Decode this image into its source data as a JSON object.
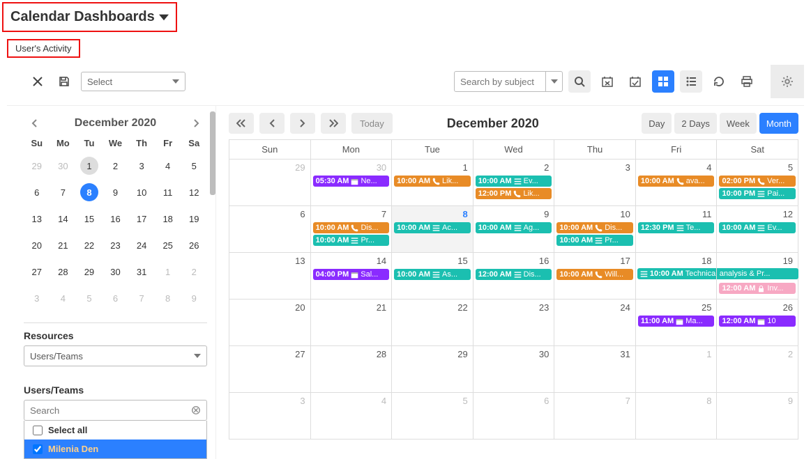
{
  "header": {
    "title": "Calendar Dashboards"
  },
  "tabs": {
    "active": "User's Activity"
  },
  "toolbar": {
    "select_placeholder": "Select",
    "search_placeholder": "Search by subject"
  },
  "mini_calendar": {
    "title": "December 2020",
    "dow": [
      "Su",
      "Mo",
      "Tu",
      "We",
      "Th",
      "Fr",
      "Sa"
    ],
    "weeks": [
      [
        {
          "n": 29,
          "dim": true
        },
        {
          "n": 30,
          "dim": true
        },
        {
          "n": 1,
          "today": true
        },
        {
          "n": 2
        },
        {
          "n": 3
        },
        {
          "n": 4
        },
        {
          "n": 5
        }
      ],
      [
        {
          "n": 6
        },
        {
          "n": 7
        },
        {
          "n": 8,
          "sel": true
        },
        {
          "n": 9
        },
        {
          "n": 10
        },
        {
          "n": 11
        },
        {
          "n": 12
        }
      ],
      [
        {
          "n": 13
        },
        {
          "n": 14
        },
        {
          "n": 15
        },
        {
          "n": 16
        },
        {
          "n": 17
        },
        {
          "n": 18
        },
        {
          "n": 19
        }
      ],
      [
        {
          "n": 20
        },
        {
          "n": 21
        },
        {
          "n": 22
        },
        {
          "n": 23
        },
        {
          "n": 24
        },
        {
          "n": 25
        },
        {
          "n": 26
        }
      ],
      [
        {
          "n": 27
        },
        {
          "n": 28
        },
        {
          "n": 29
        },
        {
          "n": 30
        },
        {
          "n": 31
        },
        {
          "n": 1,
          "dim": true
        },
        {
          "n": 2,
          "dim": true
        }
      ],
      [
        {
          "n": 3,
          "dim": true
        },
        {
          "n": 4,
          "dim": true
        },
        {
          "n": 5,
          "dim": true
        },
        {
          "n": 6,
          "dim": true
        },
        {
          "n": 7,
          "dim": true
        },
        {
          "n": 8,
          "dim": true
        },
        {
          "n": 9,
          "dim": true
        }
      ]
    ]
  },
  "resources": {
    "label": "Resources",
    "value": "Users/Teams"
  },
  "users_teams": {
    "label": "Users/Teams",
    "search_placeholder": "Search",
    "select_all": "Select all",
    "items": [
      {
        "name": "Milenia Den",
        "checked": true,
        "selected": true
      }
    ]
  },
  "calendar": {
    "title": "December 2020",
    "today_label": "Today",
    "views": [
      "Day",
      "2 Days",
      "Week",
      "Month"
    ],
    "active_view": "Month",
    "dow": [
      "Sun",
      "Mon",
      "Tue",
      "Wed",
      "Thu",
      "Fri",
      "Sat"
    ],
    "weeks": [
      {
        "days": [
          {
            "n": 29,
            "dim": true,
            "events": []
          },
          {
            "n": 30,
            "dim": true,
            "events": [
              {
                "t": "05:30 AM",
                "c": "purple",
                "i": "cal",
                "txt": "Ne..."
              }
            ]
          },
          {
            "n": 1,
            "events": [
              {
                "t": "10:00 AM",
                "c": "orange",
                "i": "phone",
                "txt": "Lik..."
              }
            ]
          },
          {
            "n": 2,
            "events": [
              {
                "t": "10:00 AM",
                "c": "teal",
                "i": "list",
                "txt": "Ev..."
              },
              {
                "t": "12:00 PM",
                "c": "orange",
                "i": "phone",
                "txt": "Lik..."
              }
            ]
          },
          {
            "n": 3,
            "events": []
          },
          {
            "n": 4,
            "events": [
              {
                "t": "10:00 AM",
                "c": "orange",
                "i": "phone",
                "txt": "ava..."
              }
            ]
          },
          {
            "n": 5,
            "events": [
              {
                "t": "02:00 PM",
                "c": "orange",
                "i": "phone",
                "txt": "Ver..."
              },
              {
                "t": "10:00 PM",
                "c": "teal",
                "i": "list",
                "txt": "Pai..."
              }
            ]
          }
        ]
      },
      {
        "days": [
          {
            "n": 6,
            "events": []
          },
          {
            "n": 7,
            "events": [
              {
                "t": "10:00 AM",
                "c": "orange",
                "i": "phone",
                "txt": "Dis..."
              },
              {
                "t": "10:00 AM",
                "c": "teal",
                "i": "list",
                "txt": "Pr..."
              }
            ]
          },
          {
            "n": 8,
            "sel": true,
            "today": true,
            "events": [
              {
                "t": "10:00 AM",
                "c": "teal",
                "i": "list",
                "txt": "Ac..."
              }
            ]
          },
          {
            "n": 9,
            "events": [
              {
                "t": "10:00 AM",
                "c": "teal",
                "i": "list",
                "txt": "Ag..."
              }
            ]
          },
          {
            "n": 10,
            "events": [
              {
                "t": "10:00 AM",
                "c": "orange",
                "i": "phone",
                "txt": "Dis..."
              },
              {
                "t": "10:00 AM",
                "c": "teal",
                "i": "list",
                "txt": "Pr..."
              }
            ]
          },
          {
            "n": 11,
            "events": [
              {
                "t": "12:30 PM",
                "c": "teal",
                "i": "list",
                "txt": "Te..."
              }
            ]
          },
          {
            "n": 12,
            "events": [
              {
                "t": "10:00 AM",
                "c": "teal",
                "i": "list",
                "txt": "Ev..."
              }
            ]
          }
        ]
      },
      {
        "days": [
          {
            "n": 13,
            "events": []
          },
          {
            "n": 14,
            "events": [
              {
                "t": "04:00 PM",
                "c": "purple",
                "i": "cal",
                "txt": "Sal..."
              }
            ]
          },
          {
            "n": 15,
            "events": [
              {
                "t": "10:00 AM",
                "c": "teal",
                "i": "list",
                "txt": "As..."
              }
            ]
          },
          {
            "n": 16,
            "events": [
              {
                "t": "12:00 AM",
                "c": "teal",
                "i": "list",
                "txt": "Dis..."
              }
            ]
          },
          {
            "n": 17,
            "events": [
              {
                "t": "10:00 AM",
                "c": "orange",
                "i": "phone",
                "txt": "Will..."
              }
            ]
          },
          {
            "n": 18,
            "span_start": true,
            "events": []
          },
          {
            "n": 19,
            "events": [
              {
                "t": "12:00 AM",
                "c": "pink",
                "i": "lock",
                "txt": "Inv..."
              }
            ]
          }
        ],
        "span": {
          "t": "10:00 AM",
          "c": "teal",
          "i": "list",
          "txt": "Technical analysis & Pr...",
          "from": 5,
          "to": 6
        }
      },
      {
        "days": [
          {
            "n": 20,
            "events": []
          },
          {
            "n": 21,
            "events": []
          },
          {
            "n": 22,
            "events": []
          },
          {
            "n": 23,
            "events": []
          },
          {
            "n": 24,
            "events": []
          },
          {
            "n": 25,
            "events": [
              {
                "t": "11:00 AM",
                "c": "purple",
                "i": "cal",
                "txt": "Ma..."
              }
            ]
          },
          {
            "n": 26,
            "events": [
              {
                "t": "12:00 AM",
                "c": "purple",
                "i": "cal",
                "txt": "10"
              }
            ]
          }
        ]
      },
      {
        "days": [
          {
            "n": 27,
            "events": []
          },
          {
            "n": 28,
            "events": []
          },
          {
            "n": 29,
            "events": []
          },
          {
            "n": 30,
            "events": []
          },
          {
            "n": 31,
            "events": []
          },
          {
            "n": 1,
            "dim": true,
            "events": []
          },
          {
            "n": 2,
            "dim": true,
            "events": []
          }
        ]
      },
      {
        "days": [
          {
            "n": 3,
            "dim": true,
            "events": []
          },
          {
            "n": 4,
            "dim": true,
            "events": []
          },
          {
            "n": 5,
            "dim": true,
            "events": []
          },
          {
            "n": 6,
            "dim": true,
            "events": []
          },
          {
            "n": 7,
            "dim": true,
            "events": []
          },
          {
            "n": 8,
            "dim": true,
            "events": []
          },
          {
            "n": 9,
            "dim": true,
            "events": []
          }
        ]
      }
    ]
  }
}
